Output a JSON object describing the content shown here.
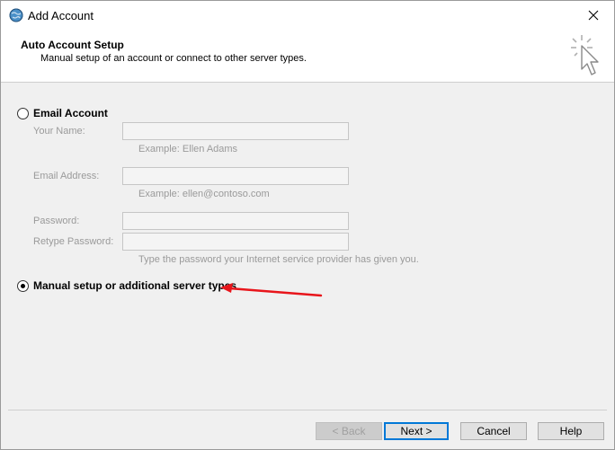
{
  "window": {
    "title": "Add Account",
    "header_title": "Auto Account Setup",
    "header_subtitle": "Manual setup of an account or connect to other server types."
  },
  "options": {
    "email_account_label": "Email Account",
    "manual_setup_label": "Manual setup or additional server types",
    "selected": "manual_setup"
  },
  "form": {
    "your_name_label": "Your Name:",
    "your_name_example": "Example: Ellen Adams",
    "email_address_label": "Email Address:",
    "email_address_example": "Example: ellen@contoso.com",
    "password_label": "Password:",
    "retype_password_label": "Retype Password:",
    "password_hint": "Type the password your Internet service provider has given you."
  },
  "buttons": {
    "back": "< Back",
    "next": "Next >",
    "cancel": "Cancel",
    "help": "Help"
  },
  "colors": {
    "annotation_arrow": "#e8151b",
    "default_button_border": "#0078d7",
    "disabled_text": "#9a9a9a"
  }
}
